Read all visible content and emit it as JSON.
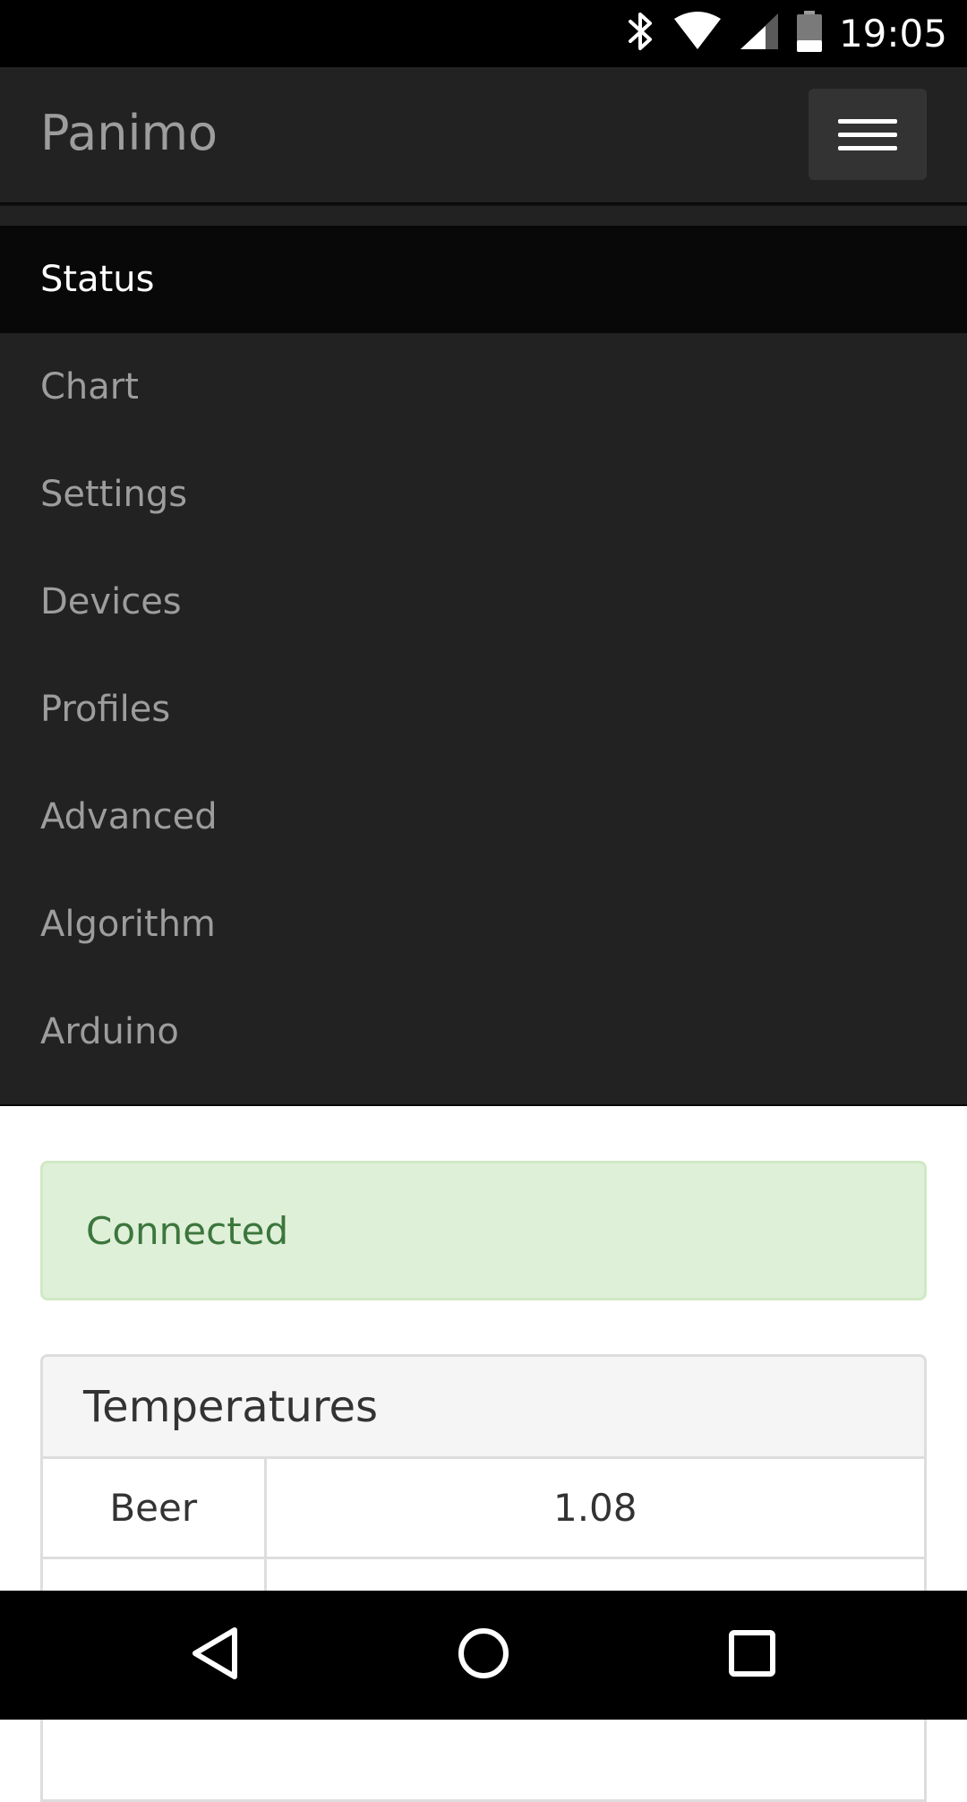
{
  "status_bar": {
    "time": "19:05",
    "icons": [
      "bluetooth-icon",
      "wifi-icon",
      "cell-signal-icon",
      "battery-icon"
    ]
  },
  "navbar": {
    "brand": "Panimo",
    "toggle_icon": "hamburger-menu-icon"
  },
  "menu": {
    "items": [
      {
        "label": "Status",
        "active": true
      },
      {
        "label": "Chart",
        "active": false
      },
      {
        "label": "Settings",
        "active": false
      },
      {
        "label": "Devices",
        "active": false
      },
      {
        "label": "Profiles",
        "active": false
      },
      {
        "label": "Advanced",
        "active": false
      },
      {
        "label": "Algorithm",
        "active": false
      },
      {
        "label": "Arduino",
        "active": false
      }
    ]
  },
  "alert": {
    "text": "Connected",
    "color": "#3c763d",
    "background": "#dff0d8"
  },
  "temperatures": {
    "title": "Temperatures",
    "rows": [
      {
        "label": "Beer",
        "value": "1.08"
      },
      {
        "label": "",
        "value": ""
      }
    ]
  },
  "system_nav": {
    "icons": [
      "back-icon",
      "home-icon",
      "recents-icon"
    ]
  }
}
